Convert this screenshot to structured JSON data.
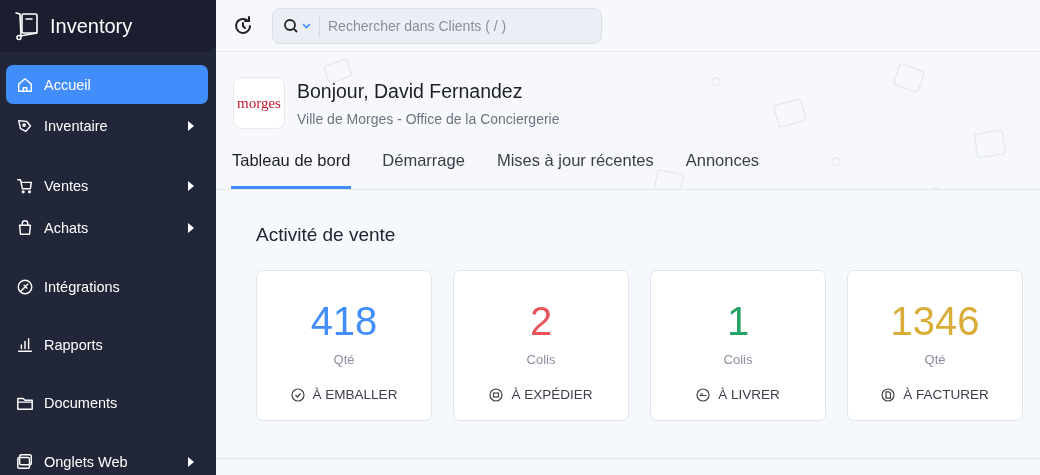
{
  "app": {
    "title": "Inventory"
  },
  "search": {
    "placeholder": "Rechercher dans Clients ( / )"
  },
  "sidebar": {
    "items": [
      {
        "label": "Accueil",
        "selected": true,
        "has_submenu": false
      },
      {
        "label": "Inventaire",
        "selected": false,
        "has_submenu": true
      },
      {
        "label": "Ventes",
        "selected": false,
        "has_submenu": true
      },
      {
        "label": "Achats",
        "selected": false,
        "has_submenu": true
      },
      {
        "label": "Intégrations",
        "selected": false,
        "has_submenu": false
      },
      {
        "label": "Rapports",
        "selected": false,
        "has_submenu": false
      },
      {
        "label": "Documents",
        "selected": false,
        "has_submenu": false
      },
      {
        "label": "Onglets Web",
        "selected": false,
        "has_submenu": true
      }
    ]
  },
  "org": {
    "logo_text": "morges",
    "greeting": "Bonjour, David Fernandez",
    "subtitle": "Ville de Morges - Office de la Conciergerie"
  },
  "tabs": [
    {
      "label": "Tableau de bord",
      "selected": true
    },
    {
      "label": "Démarrage",
      "selected": false
    },
    {
      "label": "Mises à jour récentes",
      "selected": false
    },
    {
      "label": "Annonces",
      "selected": false
    }
  ],
  "sales_activity": {
    "title": "Activité de vente",
    "cards": [
      {
        "value": "418",
        "unit": "Qté",
        "label": "À EMBALLER",
        "color": "#408dfb"
      },
      {
        "value": "2",
        "unit": "Colis",
        "label": "À EXPÉDIER",
        "color": "#e5555b"
      },
      {
        "value": "1",
        "unit": "Colis",
        "label": "À LIVRER",
        "color": "#23a465"
      },
      {
        "value": "1346",
        "unit": "Qté",
        "label": "À FACTURER",
        "color": "#d9ad37"
      }
    ]
  }
}
